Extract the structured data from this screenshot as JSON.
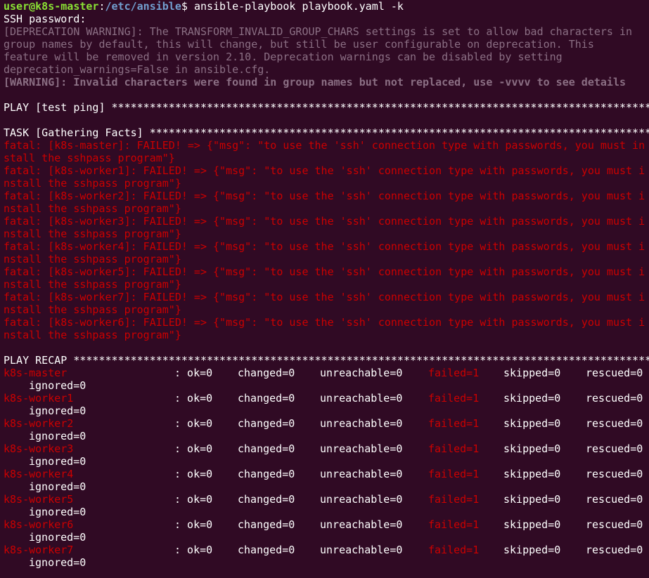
{
  "prompt": {
    "user_host": "user@k8s-master",
    "sep": ":",
    "path": "/etc/ansible",
    "dollar": "$ ",
    "command": "ansible-playbook playbook.yaml -k"
  },
  "ssh_password": "SSH password:",
  "deprecation": [
    "[DEPRECATION WARNING]: The TRANSFORM_INVALID_GROUP_CHARS settings is set to allow bad characters in",
    "group names by default, this will change, but still be user configurable on deprecation. This",
    "feature will be removed in version 2.10. Deprecation warnings can be disabled by setting",
    "deprecation_warnings=False in ansible.cfg."
  ],
  "warning": "[WARNING]: Invalid characters were found in group names but not replaced, use -vvvv to see details",
  "play_header": "PLAY [test ping] ********************************************************************************************",
  "task_header": "TASK [Gathering Facts] **************************************************************************************",
  "fatal_lines": [
    {
      "l1": "fatal: [k8s-master]: FAILED! => {\"msg\": \"to use the 'ssh' connection type with passwords, you must in",
      "l2": "stall the sshpass program\"}"
    },
    {
      "l1": "fatal: [k8s-worker1]: FAILED! => {\"msg\": \"to use the 'ssh' connection type with passwords, you must i",
      "l2": "nstall the sshpass program\"}"
    },
    {
      "l1": "fatal: [k8s-worker2]: FAILED! => {\"msg\": \"to use the 'ssh' connection type with passwords, you must i",
      "l2": "nstall the sshpass program\"}"
    },
    {
      "l1": "fatal: [k8s-worker3]: FAILED! => {\"msg\": \"to use the 'ssh' connection type with passwords, you must i",
      "l2": "nstall the sshpass program\"}"
    },
    {
      "l1": "fatal: [k8s-worker4]: FAILED! => {\"msg\": \"to use the 'ssh' connection type with passwords, you must i",
      "l2": "nstall the sshpass program\"}"
    },
    {
      "l1": "fatal: [k8s-worker5]: FAILED! => {\"msg\": \"to use the 'ssh' connection type with passwords, you must i",
      "l2": "nstall the sshpass program\"}"
    },
    {
      "l1": "fatal: [k8s-worker7]: FAILED! => {\"msg\": \"to use the 'ssh' connection type with passwords, you must i",
      "l2": "nstall the sshpass program\"}"
    },
    {
      "l1": "fatal: [k8s-worker6]: FAILED! => {\"msg\": \"to use the 'ssh' connection type with passwords, you must i",
      "l2": "nstall the sshpass program\"}"
    }
  ],
  "recap_header": "PLAY RECAP **************************************************************************************************",
  "recap_rows": [
    {
      "host": "k8s-master",
      "ok": ": ok=0",
      "changed": "changed=0",
      "unreachable": "unreachable=0",
      "failed": "failed=1",
      "skipped": "skipped=0",
      "rescued": "rescued=0",
      "ignored": "ignored=0"
    },
    {
      "host": "k8s-worker1",
      "ok": ": ok=0",
      "changed": "changed=0",
      "unreachable": "unreachable=0",
      "failed": "failed=1",
      "skipped": "skipped=0",
      "rescued": "rescued=0",
      "ignored": "ignored=0"
    },
    {
      "host": "k8s-worker2",
      "ok": ": ok=0",
      "changed": "changed=0",
      "unreachable": "unreachable=0",
      "failed": "failed=1",
      "skipped": "skipped=0",
      "rescued": "rescued=0",
      "ignored": "ignored=0"
    },
    {
      "host": "k8s-worker3",
      "ok": ": ok=0",
      "changed": "changed=0",
      "unreachable": "unreachable=0",
      "failed": "failed=1",
      "skipped": "skipped=0",
      "rescued": "rescued=0",
      "ignored": "ignored=0"
    },
    {
      "host": "k8s-worker4",
      "ok": ": ok=0",
      "changed": "changed=0",
      "unreachable": "unreachable=0",
      "failed": "failed=1",
      "skipped": "skipped=0",
      "rescued": "rescued=0",
      "ignored": "ignored=0"
    },
    {
      "host": "k8s-worker5",
      "ok": ": ok=0",
      "changed": "changed=0",
      "unreachable": "unreachable=0",
      "failed": "failed=1",
      "skipped": "skipped=0",
      "rescued": "rescued=0",
      "ignored": "ignored=0"
    },
    {
      "host": "k8s-worker6",
      "ok": ": ok=0",
      "changed": "changed=0",
      "unreachable": "unreachable=0",
      "failed": "failed=1",
      "skipped": "skipped=0",
      "rescued": "rescued=0",
      "ignored": "ignored=0"
    },
    {
      "host": "k8s-worker7",
      "ok": ": ok=0",
      "changed": "changed=0",
      "unreachable": "unreachable=0",
      "failed": "failed=1",
      "skipped": "skipped=0",
      "rescued": "rescued=0",
      "ignored": "ignored=0"
    }
  ],
  "colors": {
    "background": "#300a24",
    "prompt_user": "#8ae234",
    "prompt_path": "#729fcf",
    "fatal": "#cc0000",
    "warning": "#8b6f84"
  }
}
